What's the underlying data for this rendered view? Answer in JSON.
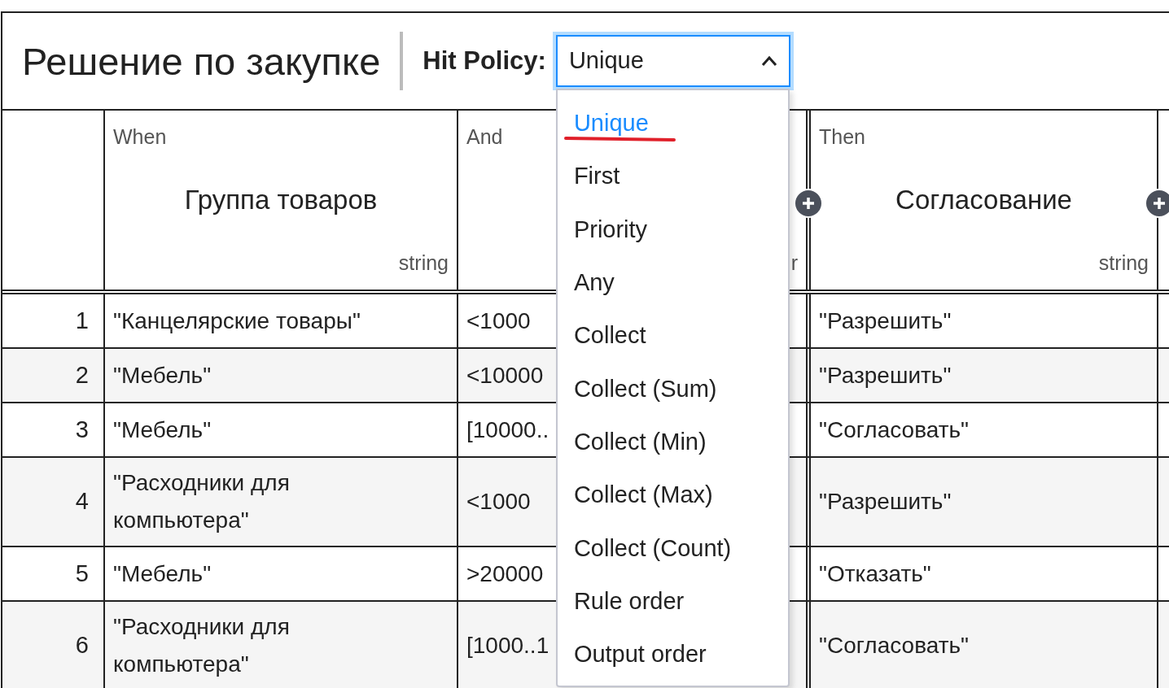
{
  "title": "Решение по закупке",
  "hit_policy": {
    "label": "Hit Policy:",
    "value": "Unique",
    "expanded": true,
    "options": [
      {
        "label": "Unique",
        "selected": true
      },
      {
        "label": "First",
        "selected": false
      },
      {
        "label": "Priority",
        "selected": false
      },
      {
        "label": "Any",
        "selected": false
      },
      {
        "label": "Collect",
        "selected": false
      },
      {
        "label": "Collect (Sum)",
        "selected": false
      },
      {
        "label": "Collect (Min)",
        "selected": false
      },
      {
        "label": "Collect (Max)",
        "selected": false
      },
      {
        "label": "Collect (Count)",
        "selected": false
      },
      {
        "label": "Rule order",
        "selected": false
      },
      {
        "label": "Output order",
        "selected": false
      }
    ]
  },
  "table": {
    "input_columns": [
      {
        "label": "When",
        "name": "Группа товаров",
        "type": "string"
      },
      {
        "label": "And",
        "type": "r"
      }
    ],
    "output_columns": [
      {
        "label": "Then",
        "name": "Согласование",
        "type": "string"
      }
    ],
    "rows": [
      {
        "index": "1",
        "cells": [
          "\"Канцелярские товары\"",
          "<1000",
          "\"Разрешить\""
        ]
      },
      {
        "index": "2",
        "cells": [
          "\"Мебель\"",
          "<10000",
          "\"Разрешить\""
        ]
      },
      {
        "index": "3",
        "cells": [
          "\"Мебель\"",
          "[10000..",
          "\"Согласовать\""
        ]
      },
      {
        "index": "4",
        "cells": [
          "\"Расходники для компьютера\"",
          "<1000",
          "\"Разрешить\""
        ]
      },
      {
        "index": "5",
        "cells": [
          "\"Мебель\"",
          ">20000",
          "\"Отказать\""
        ]
      },
      {
        "index": "6",
        "cells": [
          "\"Расходники для компьютера\"",
          "[1000..1",
          "\"Согласовать\""
        ]
      }
    ]
  }
}
